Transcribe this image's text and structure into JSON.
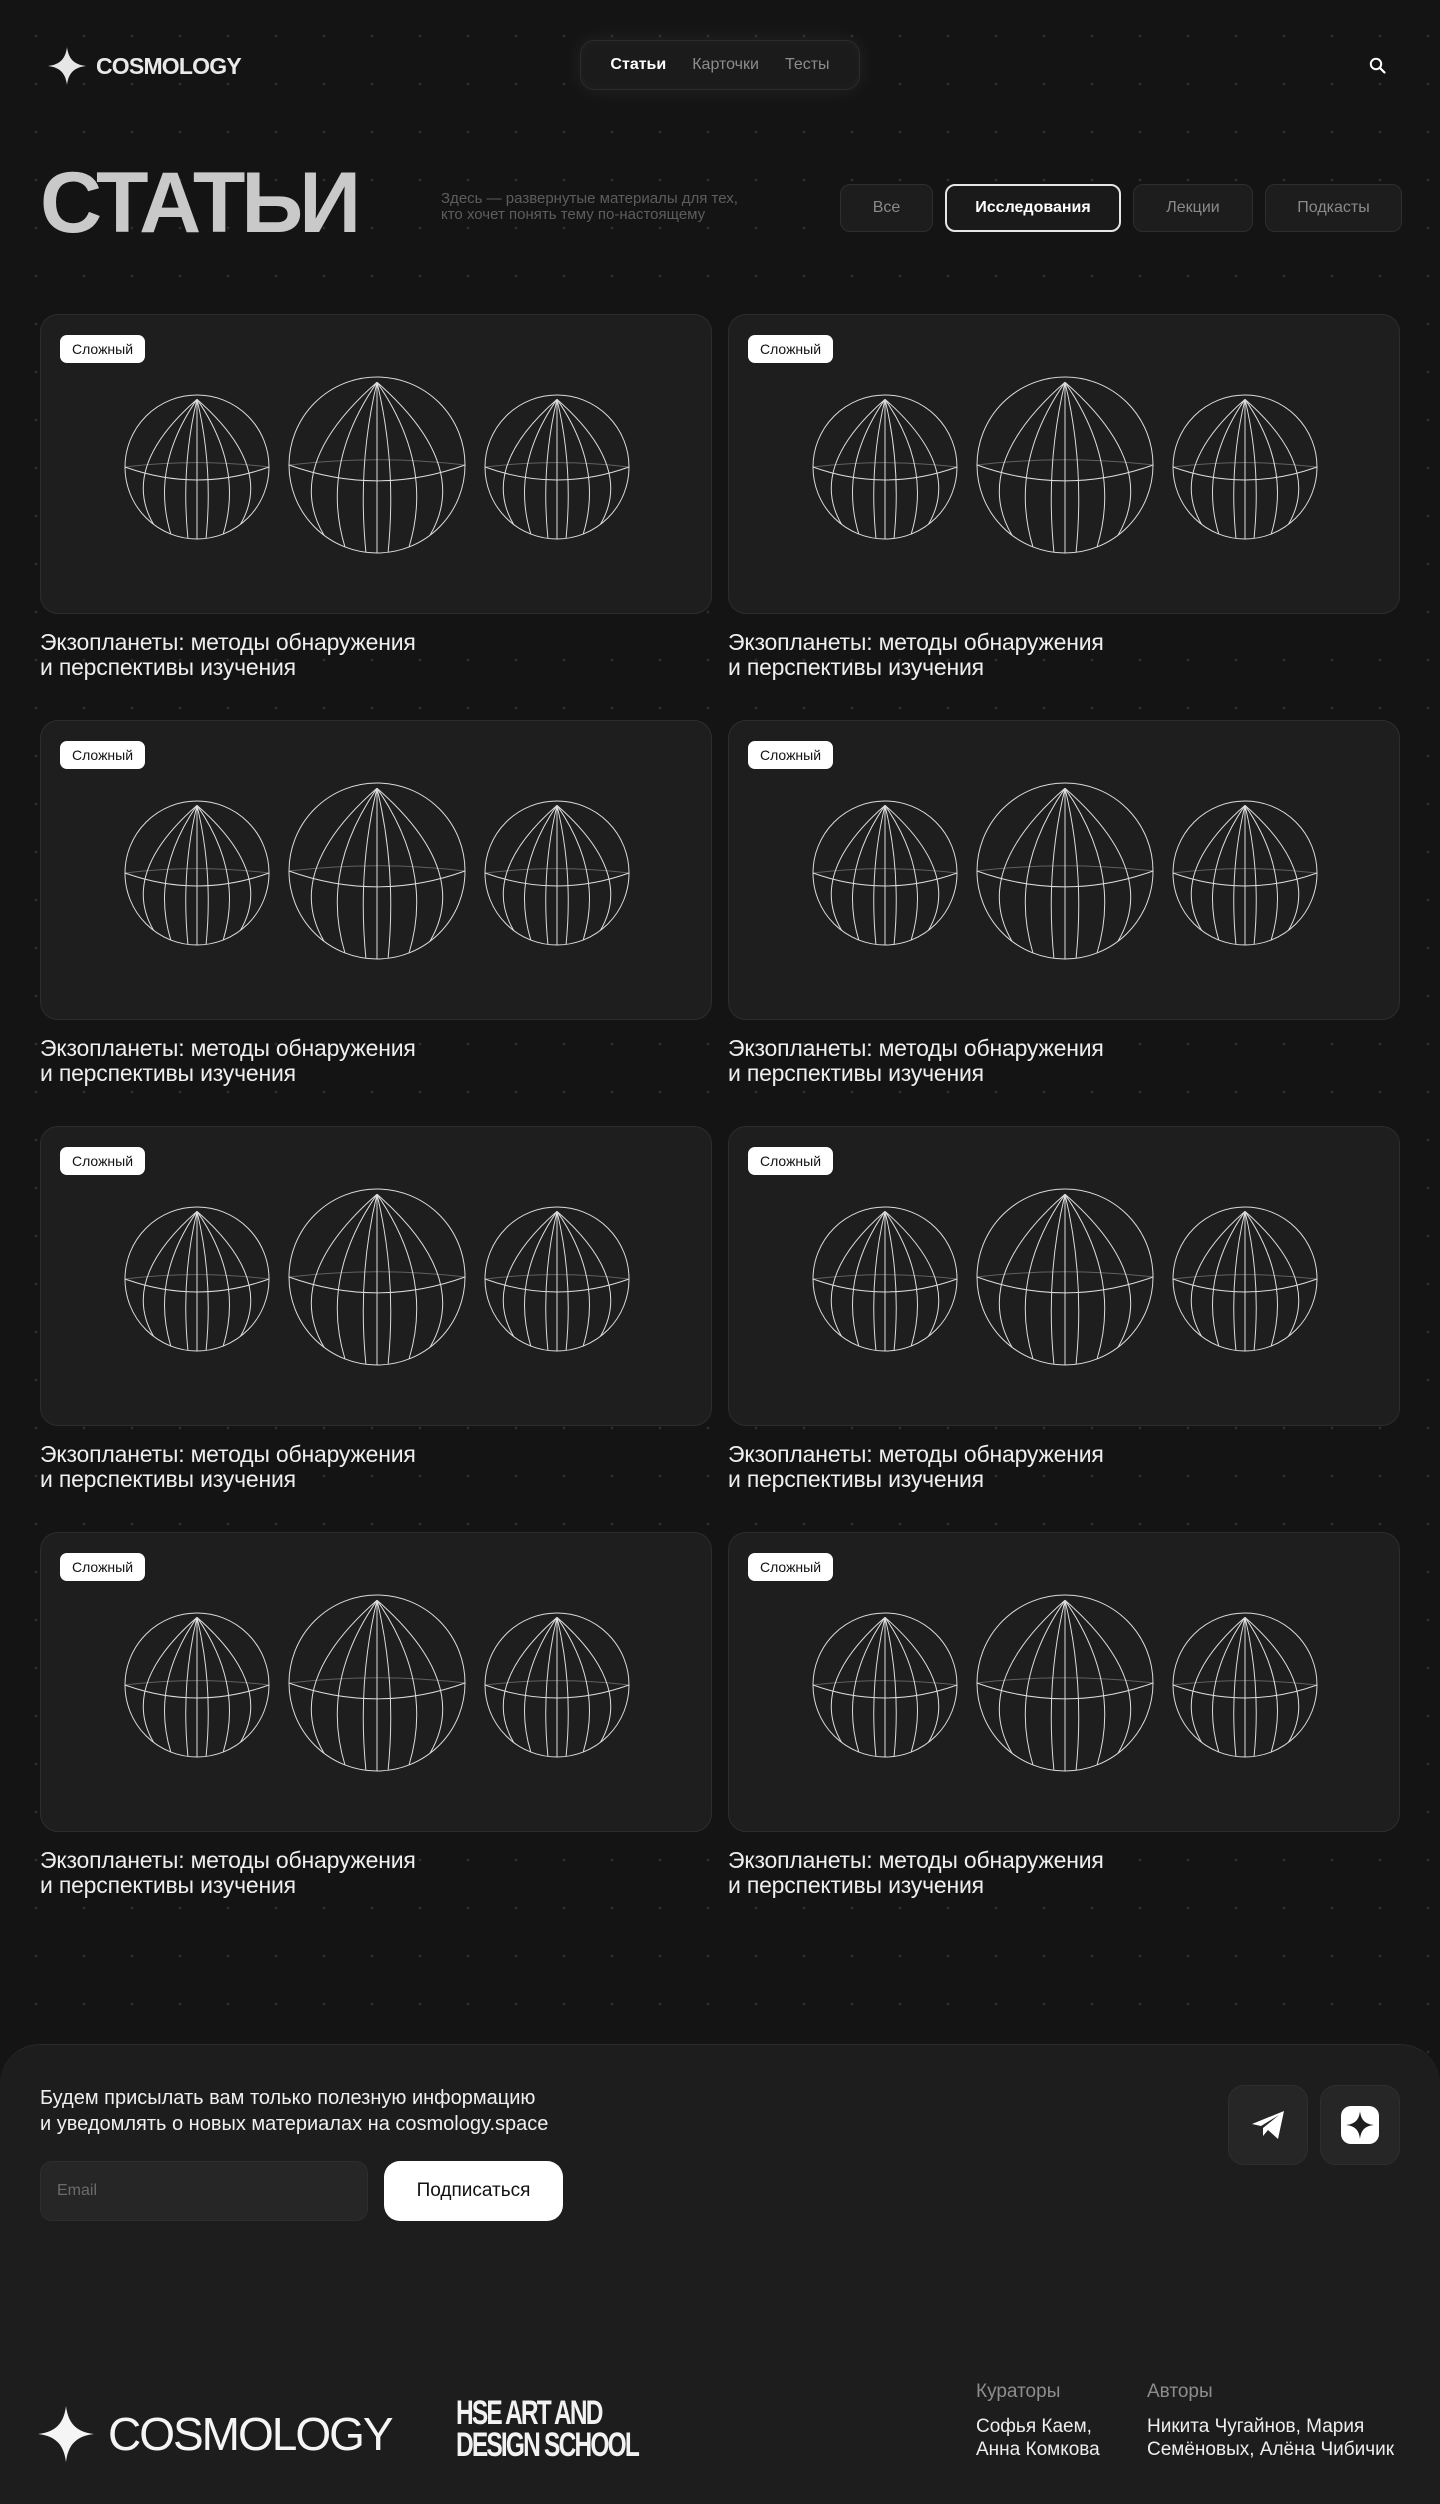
{
  "header": {
    "brand": "COSMOLOGY",
    "nav": [
      {
        "label": "Статьи",
        "active": true
      },
      {
        "label": "Карточки",
        "active": false
      },
      {
        "label": "Тесты",
        "active": false
      }
    ],
    "search_icon": "search-icon"
  },
  "intro": {
    "title": "СТАТЬИ",
    "description_line1": "Здесь — развернутые материалы для тех,",
    "description_line2": "кто хочет понять тему по-настоящему"
  },
  "filters": [
    {
      "label": "Все",
      "active": false
    },
    {
      "label": "Исследования",
      "active": true
    },
    {
      "label": "Лекции",
      "active": false
    },
    {
      "label": "Подкасты",
      "active": false
    }
  ],
  "articles": [
    {
      "badge": "Сложный",
      "title_line1": "Экзопланеты: методы обнаружения",
      "title_line2": "и перспективы изучения"
    },
    {
      "badge": "Сложный",
      "title_line1": "Экзопланеты: методы обнаружения",
      "title_line2": "и перспективы изучения"
    },
    {
      "badge": "Сложный",
      "title_line1": "Экзопланеты: методы обнаружения",
      "title_line2": "и перспективы изучения"
    },
    {
      "badge": "Сложный",
      "title_line1": "Экзопланеты: методы обнаружения",
      "title_line2": "и перспективы изучения"
    },
    {
      "badge": "Сложный",
      "title_line1": "Экзопланеты: методы обнаружения",
      "title_line2": "и перспективы изучения"
    },
    {
      "badge": "Сложный",
      "title_line1": "Экзопланеты: методы обнаружения",
      "title_line2": "и перспективы изучения"
    },
    {
      "badge": "Сложный",
      "title_line1": "Экзопланеты: методы обнаружения",
      "title_line2": "и перспективы изучения"
    },
    {
      "badge": "Сложный",
      "title_line1": "Экзопланеты: методы обнаружения",
      "title_line2": "и перспективы изучения"
    }
  ],
  "footer": {
    "newsletter_line1": "Будем присылать вам только полезную информацию",
    "newsletter_line2": "и уведомлять о новых материалах на cosmology.space",
    "email_placeholder": "Email",
    "subscribe_label": "Подписаться",
    "brand": "COSMOLOGY",
    "school_line1": "HSE ART AND",
    "school_line2": "DESIGN SCHOOL",
    "curators_label": "Кураторы",
    "curators_line1": "Софья Каем,",
    "curators_line2": "Анна Комкова",
    "authors_label": "Авторы",
    "authors_line1": "Никита Чугайнов, Мария",
    "authors_line2": "Семёновых, Алёна Чибичик"
  },
  "colors": {
    "background": "#141414",
    "card": "#1e1e1e",
    "accent": "#ffffff"
  }
}
